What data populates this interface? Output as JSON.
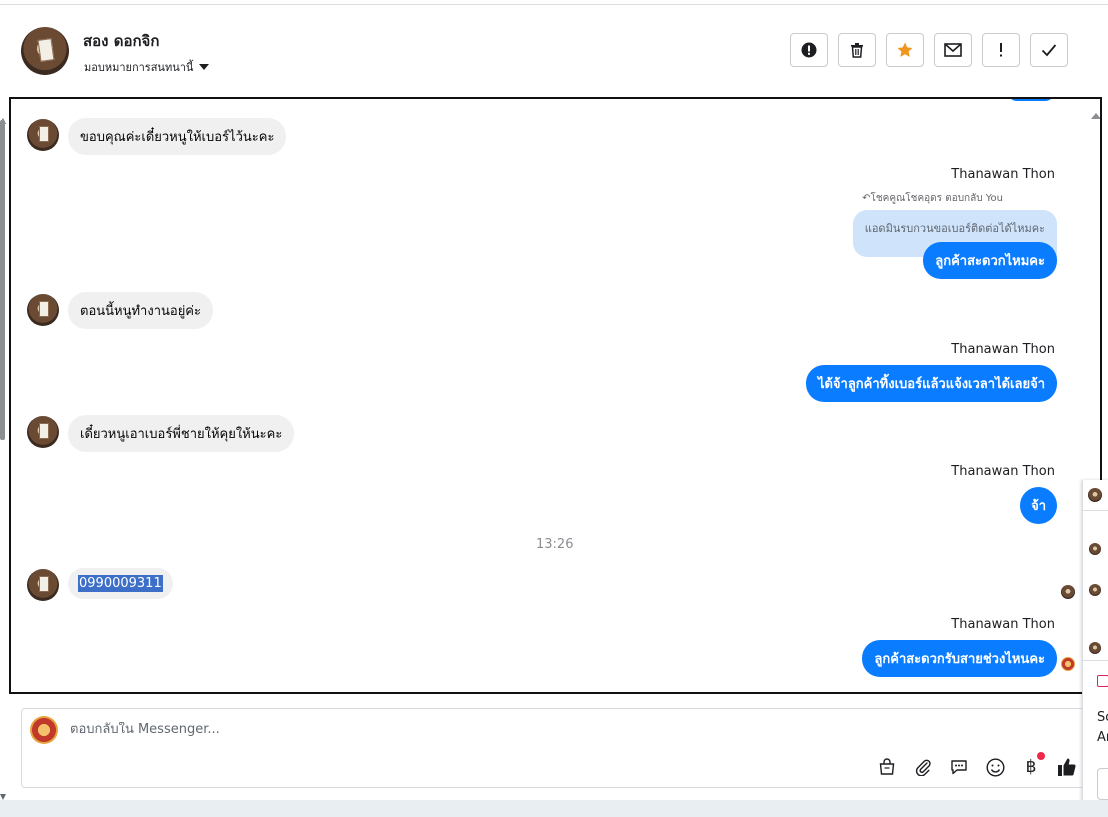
{
  "header": {
    "name": "สอง ดอกจิก",
    "assign_label": "มอบหมายการสนทนานี้",
    "toolbar": [
      {
        "name": "report-spam-button",
        "icon": "alert-circle-icon"
      },
      {
        "name": "delete-button",
        "icon": "trash-icon"
      },
      {
        "name": "star-button",
        "icon": "star-icon"
      },
      {
        "name": "mark-unread-button",
        "icon": "envelope-icon"
      },
      {
        "name": "follow-up-button",
        "icon": "exclamation-icon"
      },
      {
        "name": "mark-done-button",
        "icon": "check-icon"
      }
    ]
  },
  "messages": {
    "m1": "ขอบคุณค่ะเดี๋ยวหนูให้เบอร์ไว้นะคะ",
    "sender1": "Thanawan Thon",
    "reply_meta": "↶โชคคูณโชคอุดร ตอบกลับ You",
    "quoted": "แอดมินรบกวนขอเบอร์ติดต่อได้ไหมคะ",
    "m2": "ลูกค้าสะดวกไหมคะ",
    "m3": "ตอนนี้หนูทำงานอยู่ค่ะ",
    "sender2": "Thanawan Thon",
    "m4": "ได้จ้าลูกค้าทิ้งเบอร์แล้วแจ้งเวลาได้เลยจ้า",
    "m5": "เดี๋ยวหนูเอาเบอร์พี่ชายให้คุยให้นะคะ",
    "sender3": "Thanawan Thon",
    "m6": "จ้า",
    "timestamp": "13:26",
    "m7": "0990009311",
    "sender4": "Thanawan Thon",
    "m8": "ลูกค้าสะดวกรับสายช่วงไหนคะ"
  },
  "composer": {
    "placeholder": "ตอบกลับใน Messenger...",
    "icons": [
      "shopping-bag-icon",
      "paperclip-icon",
      "saved-reply-icon",
      "emoji-icon",
      "baht-payment-icon",
      "thumbs-up-icon"
    ]
  },
  "right_panel": {
    "partial_text_1": "So",
    "partial_text_2": "Ar"
  },
  "colors": {
    "outgoing_bubble": "#0a7cff",
    "incoming_bubble": "#f0f0f0",
    "quoted_bubble": "#cfe3fb",
    "star": "#f0961f",
    "selection": "#3e6fc8"
  }
}
